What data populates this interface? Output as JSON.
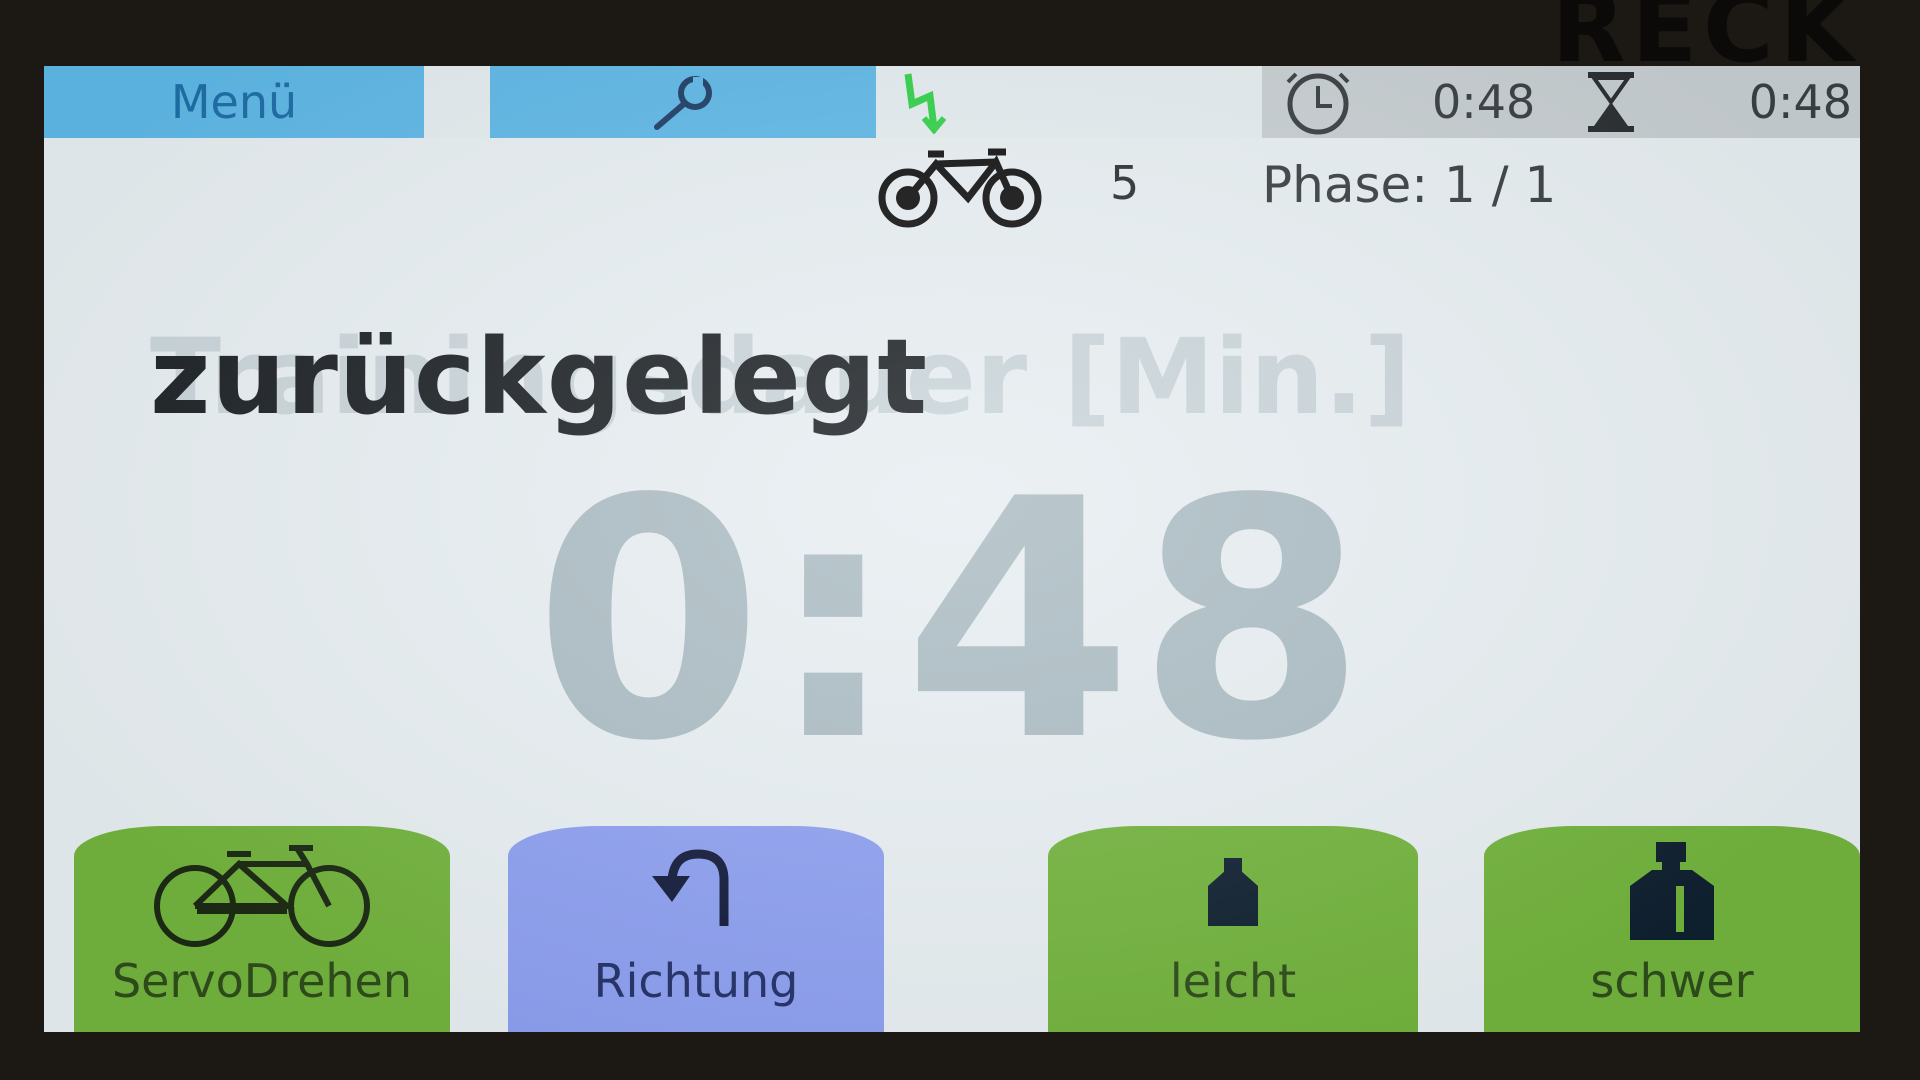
{
  "topbar": {
    "menu_label": "Menü",
    "tool_icon": "wrench-icon",
    "power_icon": "power-bolt-icon",
    "elapsed_time": "0:48",
    "remaining_time": "0:48"
  },
  "status": {
    "bike_icon": "tandem-bike-icon",
    "gear_value": "5",
    "phase": "Phase: 1 / 1"
  },
  "main": {
    "label": "zurückgelegt",
    "ghost_label": "Trainingsdauer [Min.]",
    "time_value": "0:48"
  },
  "buttons": [
    {
      "label": "ServoDrehen",
      "icon": "bicycle-icon",
      "color": "#72b33d"
    },
    {
      "label": "Richtung",
      "icon": "turn-arrow-icon",
      "color": "#8d9ff0"
    },
    {
      "label": "leicht",
      "icon": "small-weight-icon",
      "color": "#72b33d"
    },
    {
      "label": "schwer",
      "icon": "large-weight-icon",
      "color": "#72b33d"
    }
  ],
  "colors": {
    "topbar_button": "#5fb8e6",
    "timer_panel": "#c7ced1",
    "screen_background": "#e7eef1"
  }
}
